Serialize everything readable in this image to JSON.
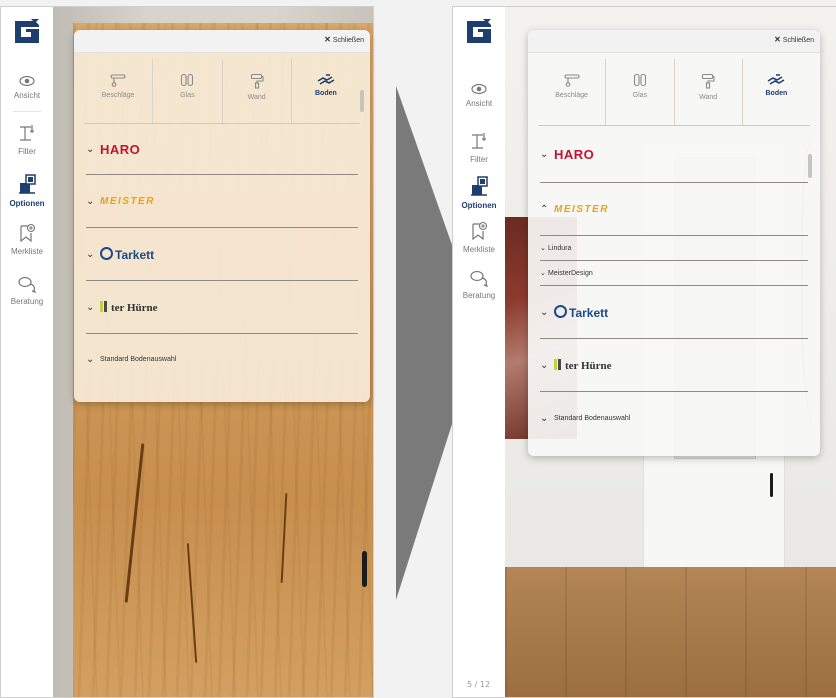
{
  "colors": {
    "accent": "#1d3e6e",
    "haro_red": "#c8102e",
    "meister_orange": "#e6a21d",
    "tarkett_blue": "#1a4a8a"
  },
  "rail": {
    "items": [
      {
        "label": "Ansicht",
        "icon": "eye-icon"
      },
      {
        "label": "Filter",
        "icon": "filter-icon"
      },
      {
        "label": "Optionen",
        "icon": "options-icon"
      },
      {
        "label": "Merkliste",
        "icon": "bookmark-add-icon"
      },
      {
        "label": "Beratung",
        "icon": "chat-icon"
      }
    ],
    "page_indicator": "5 / 12"
  },
  "panel": {
    "close_label": "Schließen",
    "tabs": [
      {
        "label": "Beschläge",
        "icon": "fitting-icon"
      },
      {
        "label": "Glas",
        "icon": "glass-icon"
      },
      {
        "label": "Wand",
        "icon": "paint-roller-icon"
      },
      {
        "label": "Boden",
        "icon": "floor-icon"
      }
    ],
    "brands": [
      {
        "label": "HARO"
      },
      {
        "label": "MEISTER"
      },
      {
        "label": "Tarkett"
      },
      {
        "label": "ter Hürne"
      },
      {
        "label": "Standard Bodenauswahl"
      }
    ],
    "meister_subitems": [
      "Lindura",
      "MeisterDesign"
    ]
  }
}
